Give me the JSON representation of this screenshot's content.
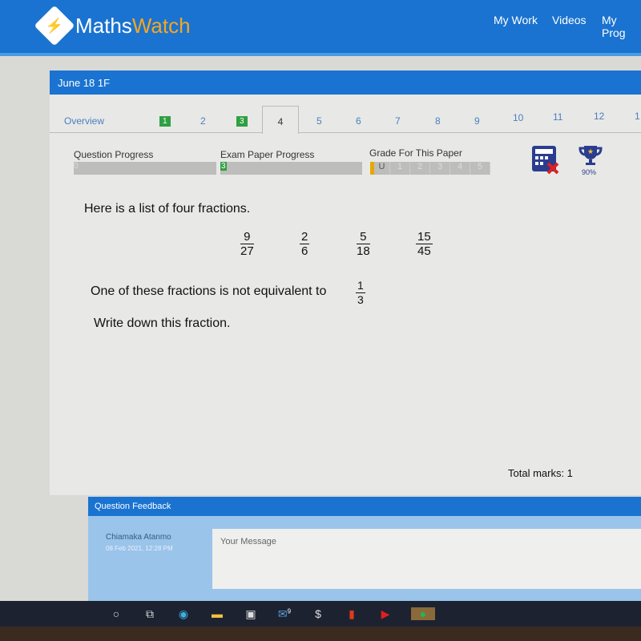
{
  "header": {
    "logo_a": "Maths",
    "logo_b": "Watch",
    "nav": [
      "My Work",
      "Videos",
      "My Prog"
    ]
  },
  "paper": {
    "title": "June 18 1F",
    "tabs": [
      {
        "label": "Overview"
      },
      {
        "label": "1",
        "state": "done"
      },
      {
        "label": "2"
      },
      {
        "label": "3",
        "state": "done"
      },
      {
        "label": "4",
        "state": "active"
      },
      {
        "label": "5"
      },
      {
        "label": "6"
      },
      {
        "label": "7"
      },
      {
        "label": "8"
      },
      {
        "label": "9"
      },
      {
        "label": "10"
      },
      {
        "label": "11"
      },
      {
        "label": "12"
      },
      {
        "label": "1"
      }
    ],
    "question_progress_label": "Question Progress",
    "question_progress_value": "0",
    "exam_progress_label": "Exam Paper Progress",
    "exam_progress_value": "3",
    "grade_label": "Grade For This Paper",
    "grades": [
      "U",
      "1",
      "2",
      "3",
      "4",
      "5"
    ],
    "current_grade": "U",
    "trophy_percent": "90%",
    "icons": [
      "calculator-not-allowed-icon",
      "trophy-icon"
    ]
  },
  "question": {
    "intro": "Here is a list of four fractions.",
    "fractions": [
      {
        "n": "9",
        "d": "27"
      },
      {
        "n": "2",
        "d": "6"
      },
      {
        "n": "5",
        "d": "18"
      },
      {
        "n": "15",
        "d": "45"
      }
    ],
    "line2": "One of these fractions is not equivalent to",
    "ref": {
      "n": "1",
      "d": "3"
    },
    "line3": "Write down this fraction.",
    "total_marks": "Total marks: 1"
  },
  "feedback": {
    "title": "Question Feedback",
    "name": "Chiamaka Atanmo",
    "date": "08 Feb 2021, 12:28 PM",
    "placeholder": "Your Message"
  },
  "taskbar": {
    "mail_badge": "9"
  }
}
